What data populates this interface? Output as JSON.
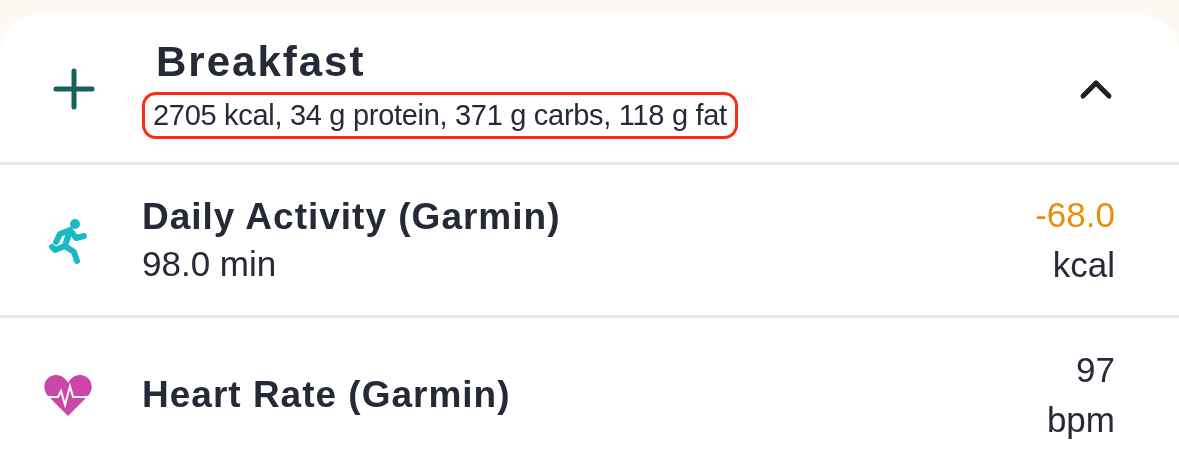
{
  "meal": {
    "title": "Breakfast",
    "summary": "2705 kcal, 34 g protein, 371 g carbs, 118 g fat",
    "summary_highlighted": true,
    "expanded": true
  },
  "entries": [
    {
      "kind": "activity",
      "title": "Daily Activity (Garmin)",
      "subtitle": "98.0 min",
      "value": "-68.0",
      "unit": "kcal"
    },
    {
      "kind": "heart",
      "title": "Heart Rate (Garmin)",
      "value": "97",
      "unit": "bpm"
    }
  ]
}
